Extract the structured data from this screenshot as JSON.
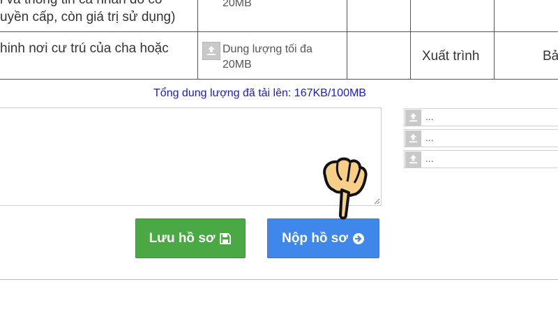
{
  "table": {
    "row1": {
      "description_line1": "i và thông tin cá nhân đó có",
      "description_line2": "uyền cấp, còn giá trị sử dụng)",
      "upload_note": "20MB"
    },
    "row2": {
      "description": "hinh nơi cư trú của cha hoặc",
      "upload_note_line1": "Dung lượng tối đa",
      "upload_note_line2": "20MB",
      "action": "Xuất trình",
      "last_col": "Bả"
    }
  },
  "upload": {
    "total_label": "Tổng dung lượng đã tải lên: 167KB/100MB",
    "slots": [
      "...",
      "...",
      "..."
    ]
  },
  "buttons": {
    "save_label": "Lưu hồ sơ",
    "submit_label": "Nộp hồ sơ"
  }
}
